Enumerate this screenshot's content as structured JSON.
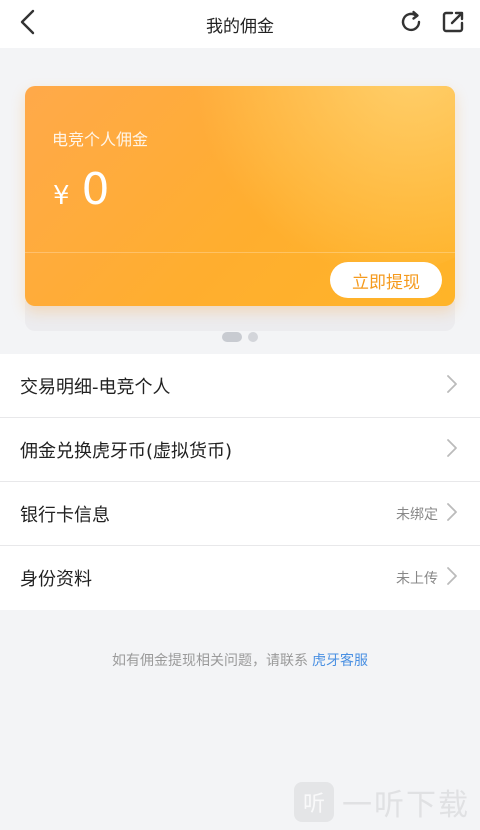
{
  "header": {
    "title": "我的佣金",
    "back_icon": "chevron-left-icon",
    "refresh_icon": "refresh-icon",
    "share_icon": "share-icon"
  },
  "card": {
    "label": "电竞个人佣金",
    "currency": "¥",
    "amount": "0",
    "withdraw_label": "立即提现",
    "accent_color": "#ffae2f"
  },
  "carousel": {
    "count": 2,
    "active_index": 0
  },
  "list": {
    "items": [
      {
        "label": "交易明细-电竞个人",
        "status": ""
      },
      {
        "label": "佣金兑换虎牙币(虚拟货币)",
        "status": ""
      },
      {
        "label": "银行卡信息",
        "status": "未绑定"
      },
      {
        "label": "身份资料",
        "status": "未上传"
      }
    ]
  },
  "footer": {
    "note": "如有佣金提现相关问题，请联系",
    "link": "虎牙客服",
    "link_color": "#4a90e2"
  },
  "watermark": {
    "logo_text": "听",
    "text": "一听下载"
  }
}
